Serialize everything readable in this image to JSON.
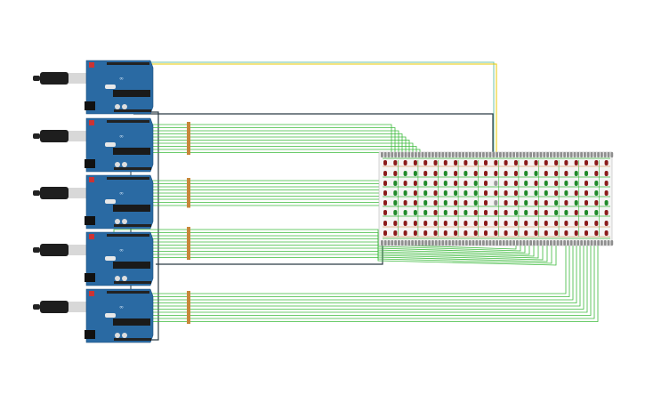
{
  "colors": {
    "board": "#2a6aa3",
    "wire_green": "#3dba3d",
    "wire_dark": "#2b3a44",
    "wire_yellow": "#e8c800",
    "wire_teal": "#6ec3a8",
    "led_red": "#8b1a1a",
    "led_green": "#1f8a2a",
    "led_off": "#9a9a9a",
    "breadboard_pin": "#8f8f8f"
  },
  "arduino_count": 5,
  "led_matrix": {
    "rows": [
      "rrrrrrrrrrrrrrrrrrrrrrr",
      "rrggrrgrgrrrrrggrrrggrr",
      "rgrrgrgrrgrxrrgrgrggrgr",
      "rggrgrggggrrrrgggrgrrgr",
      "rgrrgrgrrgrxrrgrrgrgrrg",
      "rggggrgrgrrrrggrrggrggr",
      "rrrrrrrrrrrrrrrrrrrrrrr",
      "rrrrrrrrrrrrrrrrrrrrrrr"
    ]
  }
}
